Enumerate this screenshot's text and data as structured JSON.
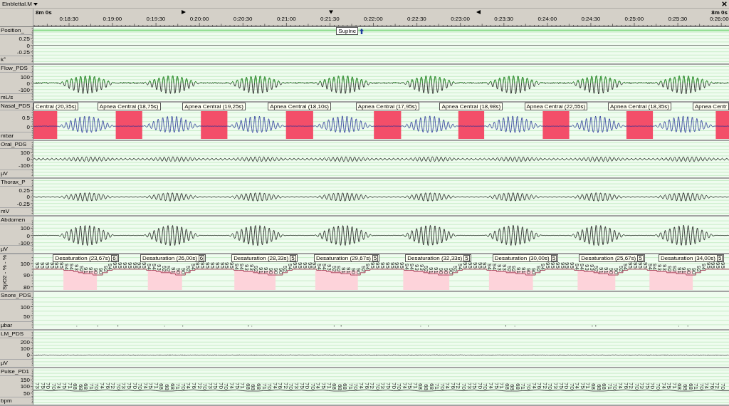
{
  "toolbar": {
    "montage": "Einblettal.M"
  },
  "time_axis": {
    "span_start": "8m 0s",
    "span_end": "8m 0s",
    "ticks": [
      "0:18:30",
      "0:19:00",
      "0:19:30",
      "0:20:00",
      "0:20:30",
      "0:21:00",
      "0:21:30",
      "0:22:00",
      "0:22:30",
      "0:23:00",
      "0:23:30",
      "0:24:00",
      "0:24:30",
      "0:25:00",
      "0:25:30",
      "0:26:00"
    ]
  },
  "channels": [
    {
      "kind": "position",
      "name": "Position_",
      "unit": "k°",
      "ticks": [
        "0.25",
        "0",
        "-0.25"
      ],
      "annotations": [
        {
          "label": "Supine"
        }
      ]
    },
    {
      "kind": "flow",
      "name": "Flow_PDS",
      "unit": "mL/s",
      "ticks": [
        "100",
        "0",
        "-100"
      ]
    },
    {
      "kind": "nasal",
      "name": "Nasal_PDS",
      "unit": "mbar",
      "ticks": [
        "0.5",
        "0"
      ],
      "events": [
        {
          "label": "Central (20,35s)"
        },
        {
          "label": "Apnea Central (18,75s)"
        },
        {
          "label": "Apnea Central (19,25s)"
        },
        {
          "label": "Apnea Central (18,10s)"
        },
        {
          "label": "Apnea Central (17,95s)"
        },
        {
          "label": "Apnea Central (18,98s)"
        },
        {
          "label": "Apnea Central (22,55s)"
        },
        {
          "label": "Apnea Central (18,35s)"
        },
        {
          "label": "Apnea Centr"
        }
      ]
    },
    {
      "kind": "oral",
      "name": "Oral_PDS",
      "unit": "µV",
      "ticks": [
        "100",
        "0",
        "-100"
      ]
    },
    {
      "kind": "thorax",
      "name": "Thorax_P",
      "unit": "mV",
      "ticks": [
        "0.25",
        "0",
        "-0.25"
      ]
    },
    {
      "kind": "abdomen",
      "name": "Abdomen",
      "unit": "µV",
      "ticks": [
        "100",
        "0",
        "-100"
      ]
    },
    {
      "kind": "spo2",
      "name": "SpO2 - % - %",
      "ticks": [
        "100",
        "90",
        "80"
      ],
      "events": [
        {
          "label": "Desaturation (23,67s)",
          "drop": "6"
        },
        {
          "label": "Desaturation (26,00s)",
          "drop": "6"
        },
        {
          "label": "Desaturation (28,33s)",
          "drop": "5"
        },
        {
          "label": "Desaturation (29,67s)",
          "drop": "5"
        },
        {
          "label": "Desaturation (32,33s)",
          "drop": "5"
        },
        {
          "label": "Desaturation (30,00s)",
          "drop": "5"
        },
        {
          "label": "Desaturation (25,67s)",
          "drop": "5"
        },
        {
          "label": "Desaturation (34,00s)",
          "drop": "5"
        }
      ],
      "value_labels": [
        "95",
        "95",
        "95",
        "95",
        "95",
        "95",
        "94",
        "94",
        "93",
        "92",
        "91",
        "91",
        "90",
        "90",
        "92",
        "94",
        "95",
        "95",
        "95",
        "95",
        "95",
        "95",
        "95",
        "94",
        "94",
        "93",
        "92",
        "92",
        "91",
        "90",
        "90",
        "92",
        "94",
        "95",
        "95",
        "95",
        "95",
        "95",
        "95",
        "95",
        "95",
        "94",
        "94",
        "93",
        "93",
        "92",
        "91",
        "91",
        "90",
        "90",
        "90",
        "92",
        "94",
        "95",
        "95",
        "95",
        "95",
        "95",
        "94",
        "94",
        "93",
        "92",
        "92",
        "91",
        "91",
        "90",
        "90",
        "92",
        "94",
        "95",
        "95",
        "95",
        "95",
        "95",
        "95",
        "95",
        "94",
        "94",
        "93",
        "93",
        "92",
        "91",
        "91",
        "90",
        "90",
        "90",
        "92",
        "94",
        "95",
        "95",
        "95",
        "95",
        "95",
        "94",
        "94",
        "93",
        "93",
        "92",
        "92",
        "91",
        "91",
        "90",
        "90",
        "92",
        "94",
        "95",
        "95",
        "95",
        "95",
        "95",
        "95",
        "94",
        "94",
        "93",
        "93",
        "92",
        "91",
        "91",
        "90",
        "90",
        "92",
        "94",
        "95",
        "95",
        "95",
        "95",
        "94",
        "94",
        "93",
        "93",
        "92",
        "92",
        "91",
        "91",
        "90",
        "90",
        "92",
        "94",
        "95",
        "95",
        "95",
        "95"
      ]
    },
    {
      "kind": "snore",
      "name": "Snore_PDS",
      "unit": "µbar",
      "ticks": [
        "100",
        "50"
      ]
    },
    {
      "kind": "limb",
      "name": "LM_PDS",
      "unit": "µV",
      "ticks": [
        "200",
        "100",
        "0"
      ]
    },
    {
      "kind": "pulse",
      "name": "Pulse_PD1",
      "unit": "bpm",
      "ticks": [
        "150",
        "100",
        "50"
      ],
      "value_labels": [
        "73",
        "75",
        "70",
        "70",
        "74",
        "75",
        "71",
        "68",
        "68",
        "68",
        "71",
        "70",
        "74",
        "76",
        "72",
        "70",
        "73",
        "75",
        "70",
        "70",
        "74",
        "75",
        "71",
        "68",
        "68",
        "68",
        "71",
        "70",
        "74",
        "76",
        "72",
        "70",
        "73",
        "75",
        "70",
        "70",
        "74",
        "75",
        "71",
        "68",
        "68",
        "68",
        "71",
        "70",
        "74",
        "76",
        "72",
        "70",
        "73",
        "75",
        "70",
        "70",
        "74",
        "75",
        "71",
        "68",
        "68",
        "68",
        "71",
        "70",
        "74",
        "76",
        "72",
        "70",
        "73",
        "75",
        "70",
        "70",
        "74",
        "75",
        "71",
        "68",
        "68",
        "68",
        "71",
        "70",
        "74",
        "76",
        "72",
        "70",
        "73",
        "75",
        "70",
        "70",
        "74",
        "75",
        "71",
        "68",
        "68",
        "68",
        "71",
        "70",
        "74",
        "76",
        "72",
        "70",
        "73",
        "75",
        "70",
        "70",
        "74",
        "75",
        "71",
        "68",
        "68",
        "68",
        "71",
        "70",
        "74",
        "76",
        "72",
        "70",
        "73",
        "75",
        "70",
        "70",
        "74",
        "75",
        "71",
        "68",
        "68",
        "68",
        "71",
        "70",
        "74",
        "76",
        "72",
        "70"
      ]
    }
  ]
}
